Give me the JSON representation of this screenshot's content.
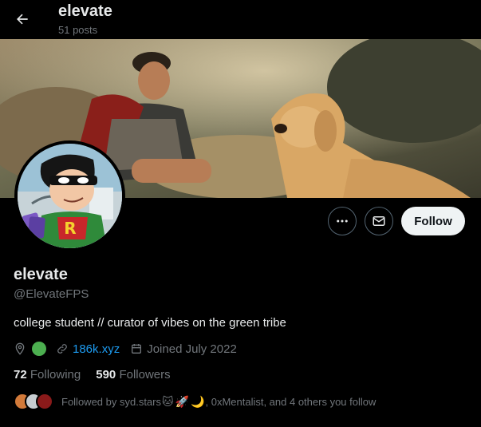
{
  "header": {
    "title": "elevate",
    "subtitle": "51 posts"
  },
  "profile": {
    "display_name": "elevate",
    "handle": "@ElevateFPS",
    "bio": "college student // curator of vibes on the green tribe",
    "website": "186k.xyz",
    "joined": "Joined July 2022",
    "following_count": "72",
    "following_label": "Following",
    "followers_count": "590",
    "followers_label": "Followers"
  },
  "actions": {
    "follow_label": "Follow",
    "more_icon": "more-icon",
    "message_icon": "mail-icon"
  },
  "followed_by": {
    "prefix": "Followed by syd.stars",
    "emojis": [
      "🐱",
      "🚀",
      "🌙"
    ],
    "suffix": ", 0xMentalist, and 4 others you follow"
  },
  "colors": {
    "background": "#000000",
    "text_primary": "#e7e9ea",
    "text_secondary": "#71767b",
    "link": "#1d9bf0",
    "follow_button_bg": "#eff3f4",
    "location_dot": "#4caf50"
  }
}
